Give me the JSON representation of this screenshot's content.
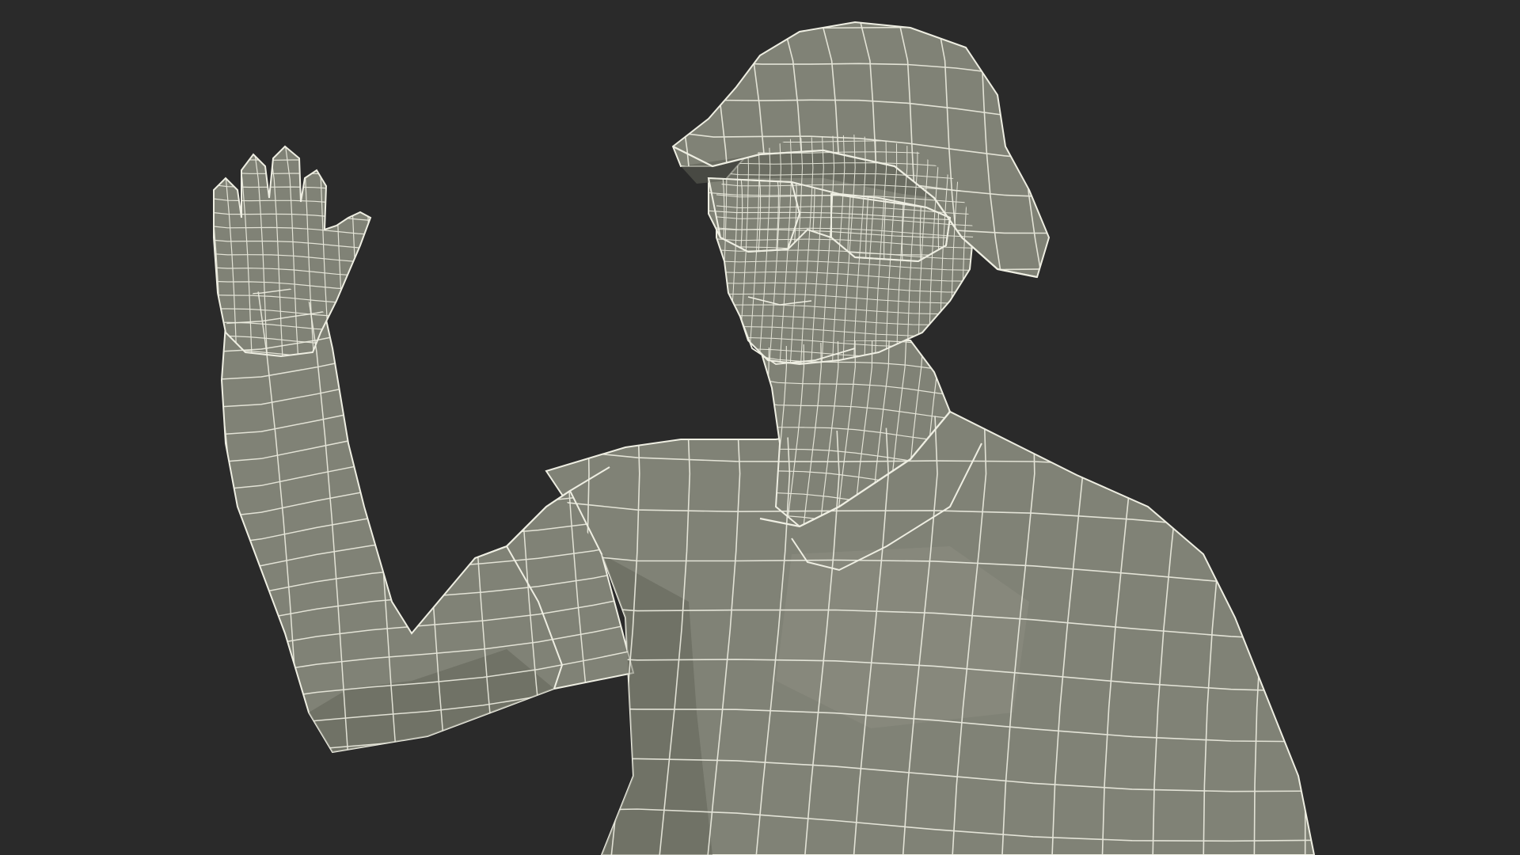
{
  "scene": {
    "background_color": "#2a2a2a",
    "mesh_fill_color": "#808276",
    "mesh_shadow_color": "#5d5f55",
    "mesh_highlight_color": "#9a9c90",
    "wire_color": "#eeeee2",
    "subject_icon": "wireframe-human-figure-icon"
  }
}
